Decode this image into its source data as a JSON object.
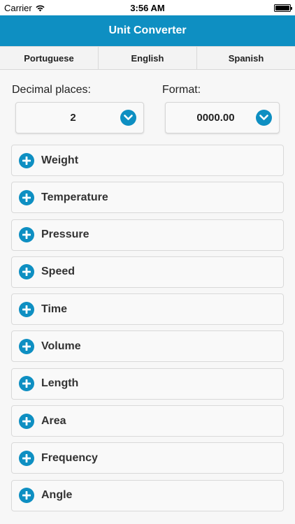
{
  "status_bar": {
    "carrier": "Carrier",
    "time": "3:56 AM",
    "icons": [
      "wifi-icon",
      "battery-icon"
    ]
  },
  "nav": {
    "title": "Unit Converter"
  },
  "colors": {
    "accent": "#0e8fc2",
    "background": "#f7f7f7"
  },
  "languages": [
    "Portuguese",
    "English",
    "Spanish"
  ],
  "options": {
    "decimal_label": "Decimal places:",
    "decimal_value": "2",
    "format_label": "Format:",
    "format_value": "0000.00"
  },
  "categories": [
    {
      "label": "Weight"
    },
    {
      "label": "Temperature"
    },
    {
      "label": "Pressure"
    },
    {
      "label": "Speed"
    },
    {
      "label": "Time"
    },
    {
      "label": "Volume"
    },
    {
      "label": "Length"
    },
    {
      "label": "Area"
    },
    {
      "label": "Frequency"
    },
    {
      "label": "Angle"
    }
  ]
}
